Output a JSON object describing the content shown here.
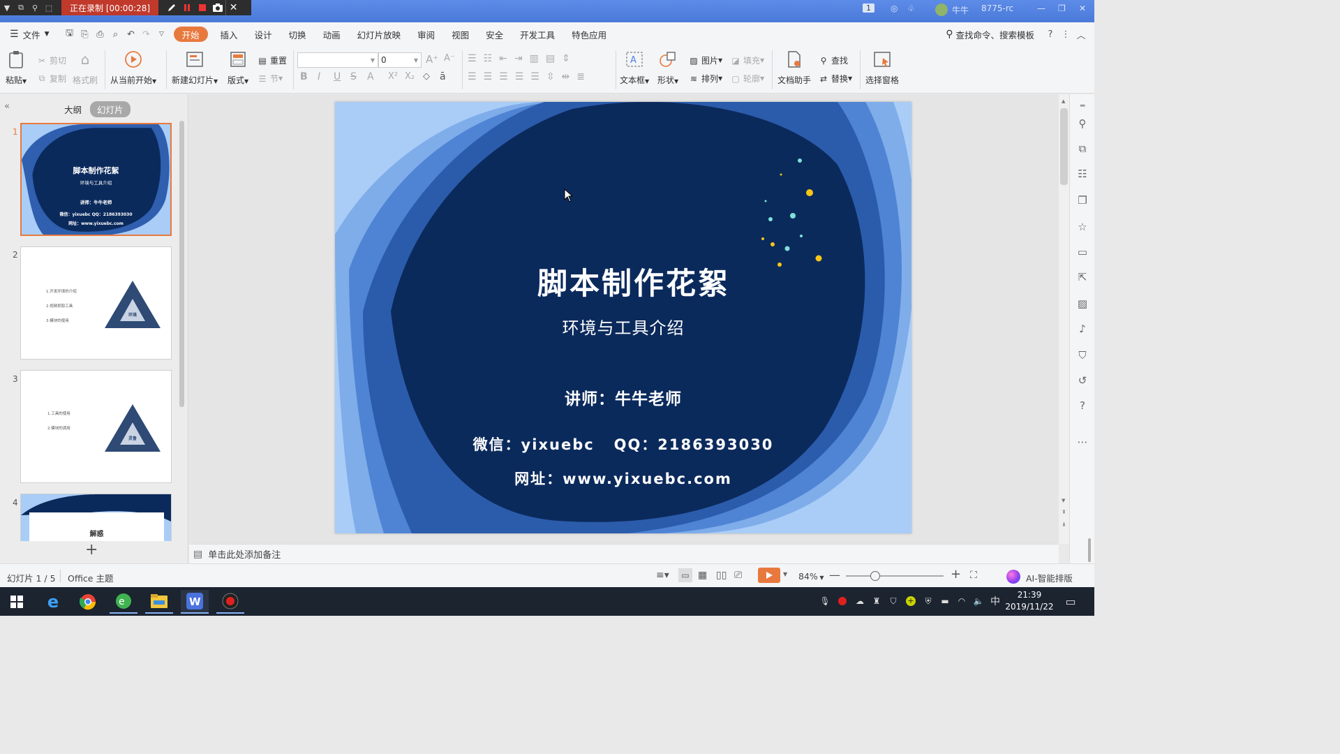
{
  "recorder": {
    "status": "正在录制 [00:00:28]"
  },
  "titlebar": {
    "page_indicator": "1",
    "user_name": "牛牛",
    "file_label": "8775-rc"
  },
  "menu": {
    "file": "文件",
    "tabs": [
      "开始",
      "插入",
      "设计",
      "切换",
      "动画",
      "幻灯片放映",
      "审阅",
      "视图",
      "安全",
      "开发工具",
      "特色应用"
    ],
    "search": "查找命令、搜索模板"
  },
  "ribbon": {
    "paste": "粘贴",
    "cut": "剪切",
    "copy": "复制",
    "format_painter": "格式刷",
    "play_from_current": "从当前开始",
    "new_slide": "新建幻灯片",
    "layout": "版式",
    "reset": "重置",
    "section": "节",
    "font_size": "0",
    "textbox": "文本框",
    "shape": "形状",
    "picture": "图片",
    "fill": "填充",
    "arrange": "排列",
    "outline": "轮廓",
    "doc_helper": "文档助手",
    "find": "查找",
    "replace": "替换",
    "selection_pane": "选择窗格"
  },
  "leftpanel": {
    "outline_tab": "大纲",
    "slides_tab": "幻灯片",
    "thumbs": [
      {
        "num": "1",
        "title": "脚本制作花絮",
        "subtitle": "环境与工具介绍",
        "line1": "讲师：牛牛老师",
        "line2": "微信：yixuebc  QQ：2186393030",
        "line3": "网址：www.yixuebc.com"
      },
      {
        "num": "2",
        "items": [
          "1.开发环境的介绍",
          "2.视频抓取工具",
          "3.模块的使用"
        ],
        "tri_label": "环境"
      },
      {
        "num": "3",
        "items": [
          "1.工具的使用",
          "2.模块的调用"
        ],
        "tri_label": "灵鲁"
      },
      {
        "num": "4",
        "title": "解惑"
      }
    ]
  },
  "slide": {
    "title": "脚本制作花絮",
    "subtitle": "环境与工具介绍",
    "teacher": "讲师：牛牛老师",
    "contact": "微信：yixuebc   QQ：2186393030",
    "website": "网址：www.yixuebc.com"
  },
  "notes": {
    "placeholder": "单击此处添加备注"
  },
  "status": {
    "slide_counter": "幻灯片 1 / 5",
    "theme": "Office 主题",
    "zoom": "84%",
    "zoom_fraction": 0.3,
    "ai_layout": "AI-智能排版"
  },
  "taskbar": {
    "time": "21:39",
    "date": "2019/11/22",
    "ime": "中"
  },
  "colors": {
    "accent": "#e8793e",
    "slide_dark": "#0b2a5c",
    "slide_light": "#a9cdf7",
    "titlebar": "#4f7fe0",
    "taskbar": "#1c2430"
  }
}
